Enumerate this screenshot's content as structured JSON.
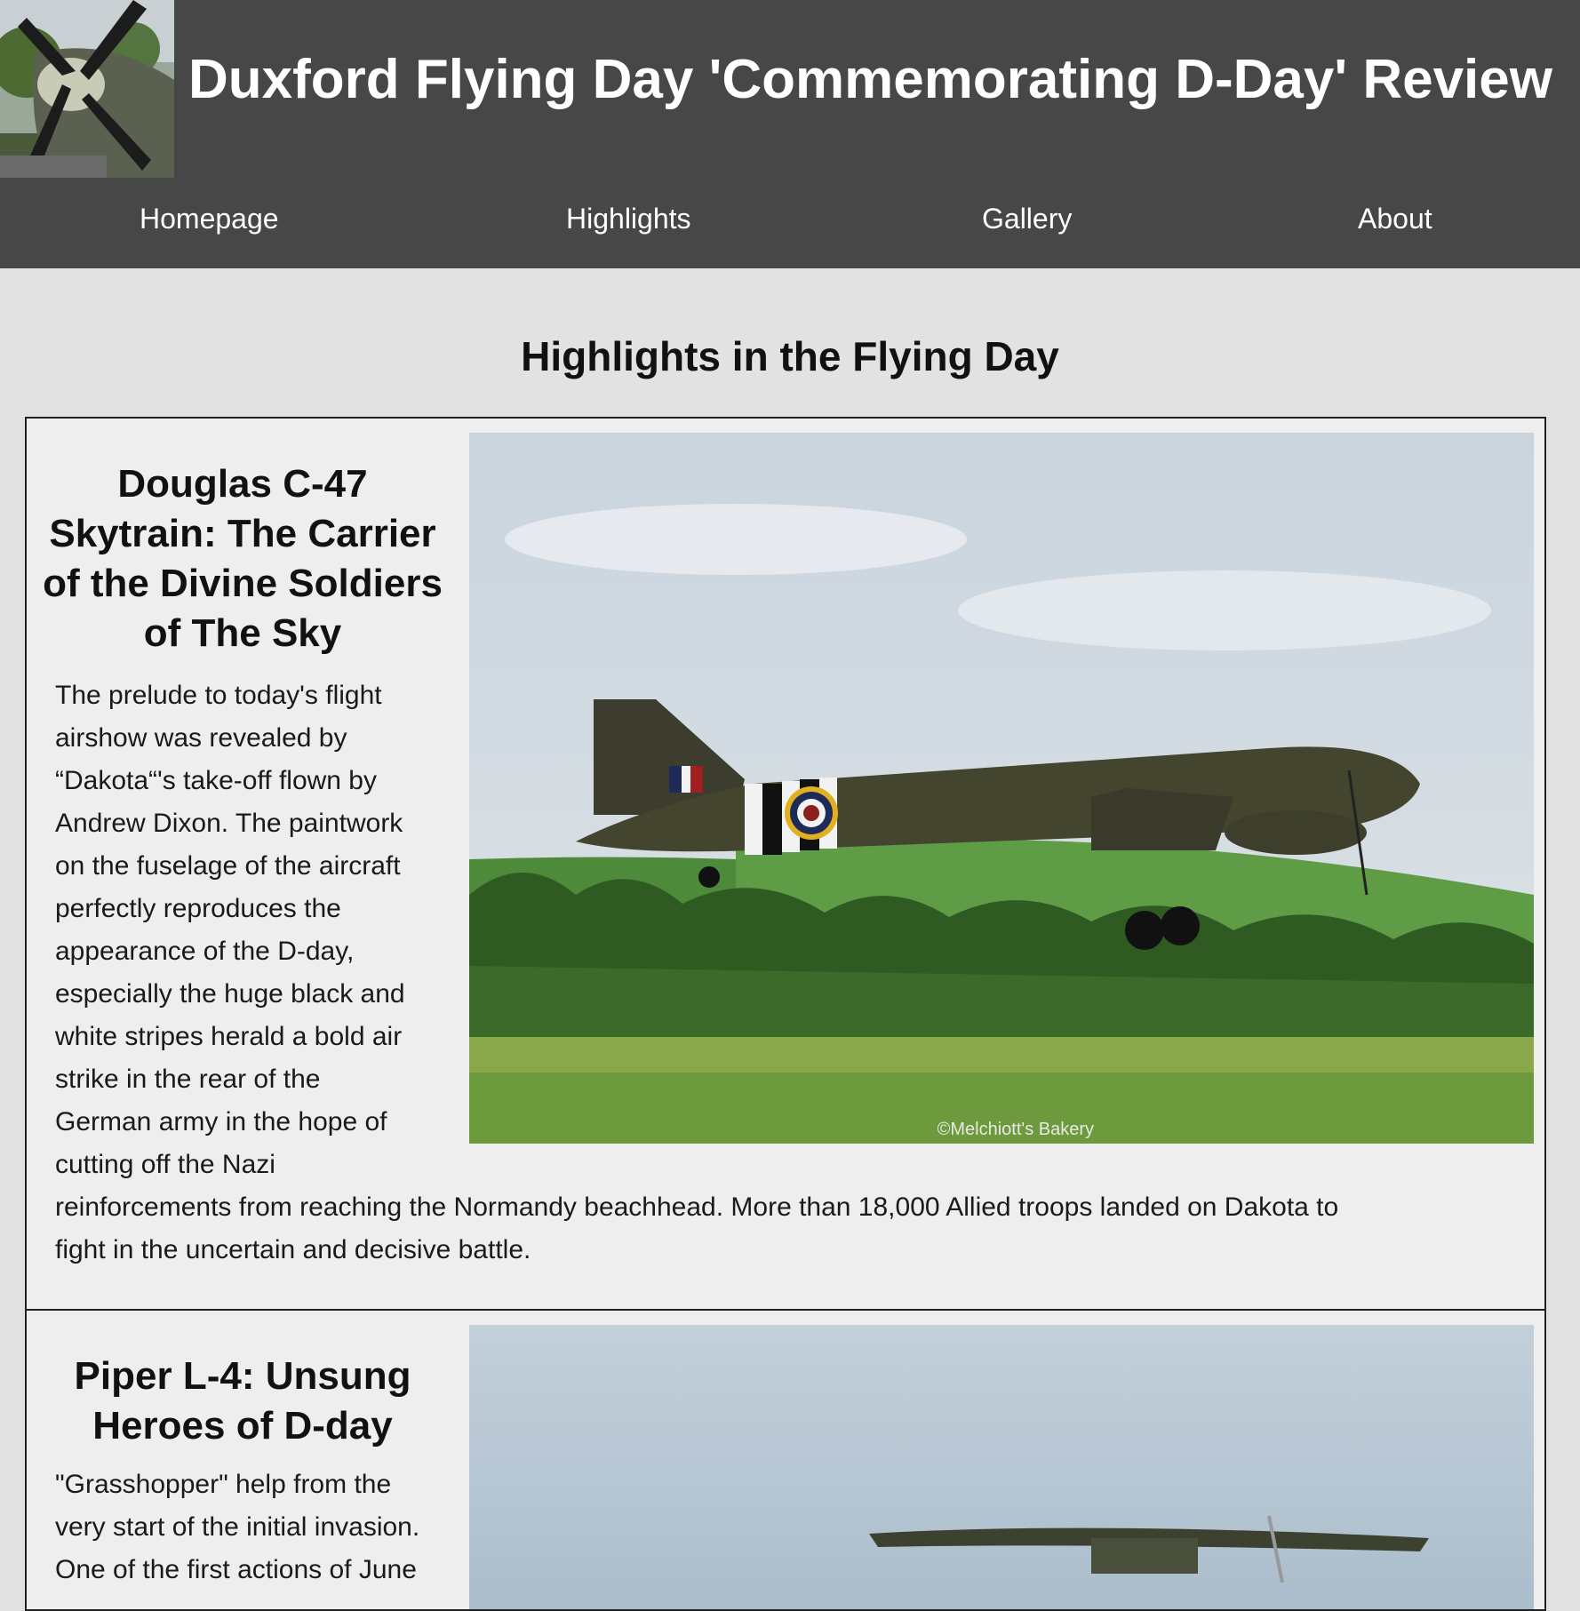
{
  "site": {
    "title": "Duxford Flying Day 'Commemorating D-Day' Review",
    "logo_icon": "spitfire-propeller-photo"
  },
  "nav": {
    "items": [
      {
        "label": "Homepage"
      },
      {
        "label": "Highlights"
      },
      {
        "label": "Gallery"
      },
      {
        "label": "About"
      }
    ]
  },
  "page": {
    "section_title": "Highlights in the Flying Day"
  },
  "highlights": [
    {
      "heading": "Douglas C-47 Skytrain: The Carrier of the Divine Soldiers of The Sky",
      "text_lines": [
        "The prelude to today's flight",
        "airshow was revealed by",
        "“Dakota“'s take-off flown by",
        "Andrew Dixon. The paintwork",
        "on the fuselage of the aircraft",
        "perfectly reproduces the",
        "appearance of the D-day,",
        "especially the huge black and",
        "white stripes herald a bold air",
        "strike in the rear of the",
        "German army in the hope of",
        "cutting off the Nazi",
        "reinforcements from reaching the Normandy beachhead. More than 18,000 Allied troops landed on Dakota to",
        "fight in the uncertain and decisive battle."
      ],
      "photo_icon": "c47-dakota-takeoff-photo",
      "photo_credit": "©Melchiott's Bakery"
    },
    {
      "heading": "Piper L-4: Unsung Heroes of D-day",
      "text_lines": [
        "\"Grasshopper\" help from the",
        "very start of the initial invasion.",
        "One of the first actions of June"
      ],
      "photo_icon": "piper-l4-grasshopper-photo"
    }
  ],
  "colors": {
    "header_bg": "#474747",
    "page_bg": "#e1e2e1",
    "card_bg": "#eeeeee",
    "nav_text": "#ffffff"
  }
}
